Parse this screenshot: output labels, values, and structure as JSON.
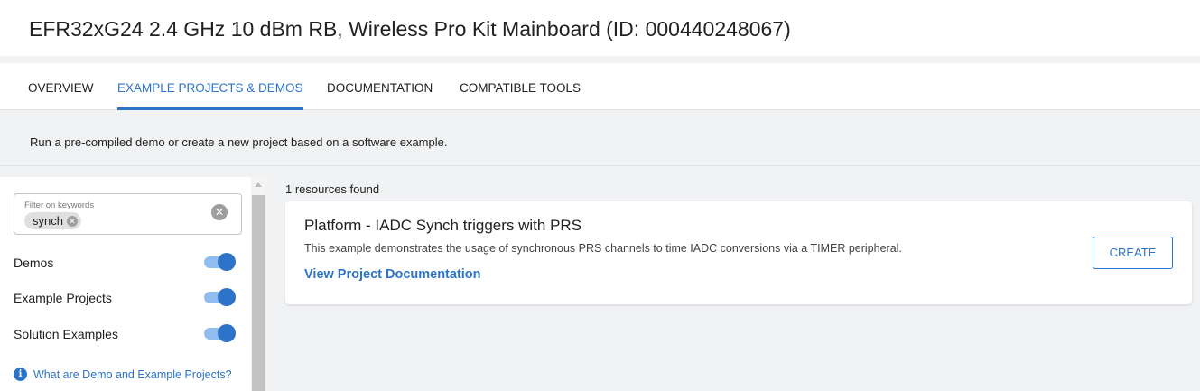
{
  "page": {
    "title": "EFR32xG24 2.4 GHz 10 dBm RB, Wireless Pro Kit Mainboard (ID: 000440248067)"
  },
  "tabs": [
    {
      "label": "OVERVIEW",
      "active": false
    },
    {
      "label": "EXAMPLE PROJECTS & DEMOS",
      "active": true
    },
    {
      "label": "DOCUMENTATION",
      "active": false
    },
    {
      "label": "COMPATIBLE TOOLS",
      "active": false
    }
  ],
  "banner": {
    "text": "Run a pre-compiled demo or create a new project based on a software example."
  },
  "filter": {
    "label": "Filter on keywords",
    "chip": "synch",
    "chip_remove_icon": "close-circle-icon",
    "clear_icon": "close-circle-icon"
  },
  "toggles": [
    {
      "label": "Demos",
      "on": true
    },
    {
      "label": "Example Projects",
      "on": true
    },
    {
      "label": "Solution Examples",
      "on": true
    }
  ],
  "help": {
    "icon": "info-icon",
    "text": "What are Demo and Example Projects?"
  },
  "results": {
    "count_text": "1 resources found",
    "items": [
      {
        "title": "Platform - IADC Synch triggers with PRS",
        "description": "This example demonstrates the usage of synchronous PRS channels to time IADC conversions via a TIMER peripheral.",
        "link": "View Project Documentation",
        "button": "CREATE"
      }
    ]
  },
  "colors": {
    "accent": "#2d74c8",
    "toggle_track": "#90bdf0",
    "background": "#f1f2f3"
  }
}
